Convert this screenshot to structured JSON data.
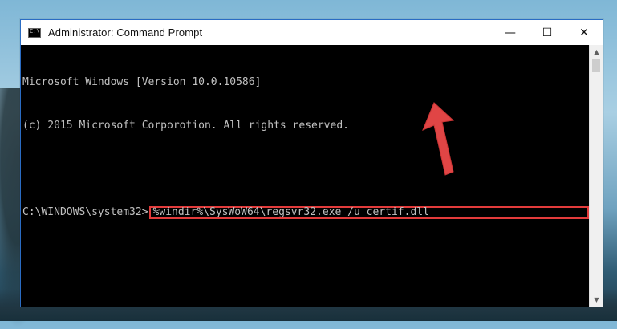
{
  "window": {
    "title": "Administrator: Command Prompt",
    "controls": {
      "minimize": "—",
      "maximize": "☐",
      "close": "✕"
    }
  },
  "console": {
    "lines": [
      "Microsoft Windows [Version 10.0.10586]",
      "(c) 2015 Microsoft Corporotion. All rights reserved.",
      ""
    ],
    "prompt": "C:\\WINDOWS\\system32>",
    "command": "%windir%\\SysWoW64\\regsvr32.exe /u certif.dll"
  },
  "scrollbar": {
    "up_arrow": "▲",
    "down_arrow": "▼"
  },
  "colors": {
    "highlight_box": "#e23b3b",
    "arrow": "#e04545",
    "console_text": "#c0c0c0",
    "console_bg": "#000000"
  },
  "icons": [
    "cmd-icon",
    "minimize-icon",
    "maximize-icon",
    "close-icon",
    "arrow-pointer-icon"
  ]
}
